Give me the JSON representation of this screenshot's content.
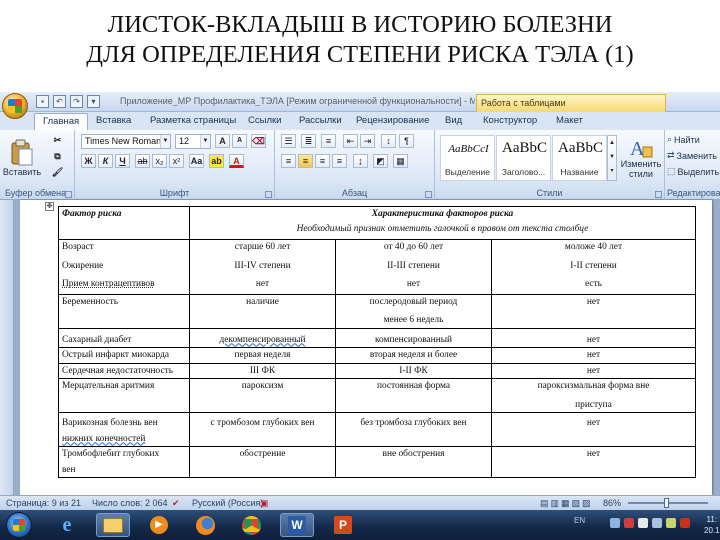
{
  "slide": {
    "title_line1": "ЛИСТОК-ВКЛАДЫШ В ИСТОРИЮ БОЛЕЗНИ",
    "title_line2": "ДЛЯ ОПРЕДЕЛЕНИЯ СТЕПЕНИ РИСКА ТЭЛА (1)"
  },
  "window": {
    "doc_title": "Приложение_МР Профилактика_ТЭЛА [Режим ограниченной функциональности] - Microsoft Word",
    "context_tab": "Работа с таблицами"
  },
  "tabs": [
    "Главная",
    "Вставка",
    "Разметка страницы",
    "Ссылки",
    "Рассылки",
    "Рецензирование",
    "Вид",
    "Конструктор",
    "Макет"
  ],
  "ribbon": {
    "paste_label": "Вставить",
    "clipboard_label": "Буфер обмена",
    "font_name": "Times New Roman",
    "font_size": "12",
    "font_group_label": "Шрифт",
    "paragraph_group_label": "Абзац",
    "styles": [
      {
        "sample": "AaBbCcI",
        "name": "Выделение"
      },
      {
        "sample": "AaBbC",
        "name": "Заголово..."
      },
      {
        "sample": "AaBbC",
        "name": "Название"
      }
    ],
    "change_styles_label": "Изменить стили",
    "styles_group_label": "Стили",
    "find_label": "Найти",
    "replace_label": "Заменить",
    "select_label": "Выделить",
    "editing_group_label": "Редактирование"
  },
  "table": {
    "header_factor": "Фактор риска",
    "header_characteristic": "Характеристика факторов риска",
    "header_note": "Необходимый признак отметить галочкой в правом от текста столбце",
    "rows": [
      {
        "factor": "Возраст",
        "c1": "старше 60 лет",
        "c2": "от 40 до 60 лет",
        "c3": "моложе 40 лет"
      },
      {
        "factor": "Ожирение",
        "c1": "III-IV степени",
        "c2": "II-III степени",
        "c3": "I-II степени"
      },
      {
        "factor": "Прием контрацептивов",
        "c1": "нет",
        "c2": "нет",
        "c3": "есть"
      },
      {
        "factor": "Беременность",
        "c1": "наличие",
        "c2": "послеродовый период",
        "c2b": "менее 6 недель",
        "c3": "нет"
      },
      {
        "factor": "Сахарный диабет",
        "c1": "декомпенсированный",
        "c2": "компенсированный",
        "c3": "нет"
      },
      {
        "factor": "Острый инфаркт миокарда",
        "c1": "первая неделя",
        "c2": "вторая неделя и более",
        "c3": "нет"
      },
      {
        "factor": "Сердечная недостаточность",
        "c1": "III ФК",
        "c2": "I-II ФК",
        "c3": "нет"
      },
      {
        "factor": "Мерцательная аритмия",
        "c1": "пароксизм",
        "c2": "постоянная форма",
        "c3": "пароксизмальная форма вне",
        "c3b": "приступа"
      },
      {
        "factor": "Варикозная болезнь вен",
        "factor2": "нижних конечностей",
        "c1": "с тромбозом глубоких вен",
        "c2": "без тромбоза глубоких вен",
        "c3": "нет"
      },
      {
        "factor": "Тромбофлебит глубоких",
        "factor2": "вен",
        "c1": "обострение",
        "c2": "вне обострения",
        "c3": "нет"
      }
    ]
  },
  "statusbar": {
    "page": "Страница: 9 из 21",
    "words": "Число слов: 2 064",
    "language": "Русский (Россия)",
    "zoom": "86%"
  },
  "taskbar": {
    "tray_text": "EN",
    "clock_line1": "11:",
    "clock_line2": "20.1"
  },
  "colors": {
    "ribbon_bg": "#dde8f6",
    "context_tab": "#f6d873",
    "taskbar": "#142a4a"
  }
}
